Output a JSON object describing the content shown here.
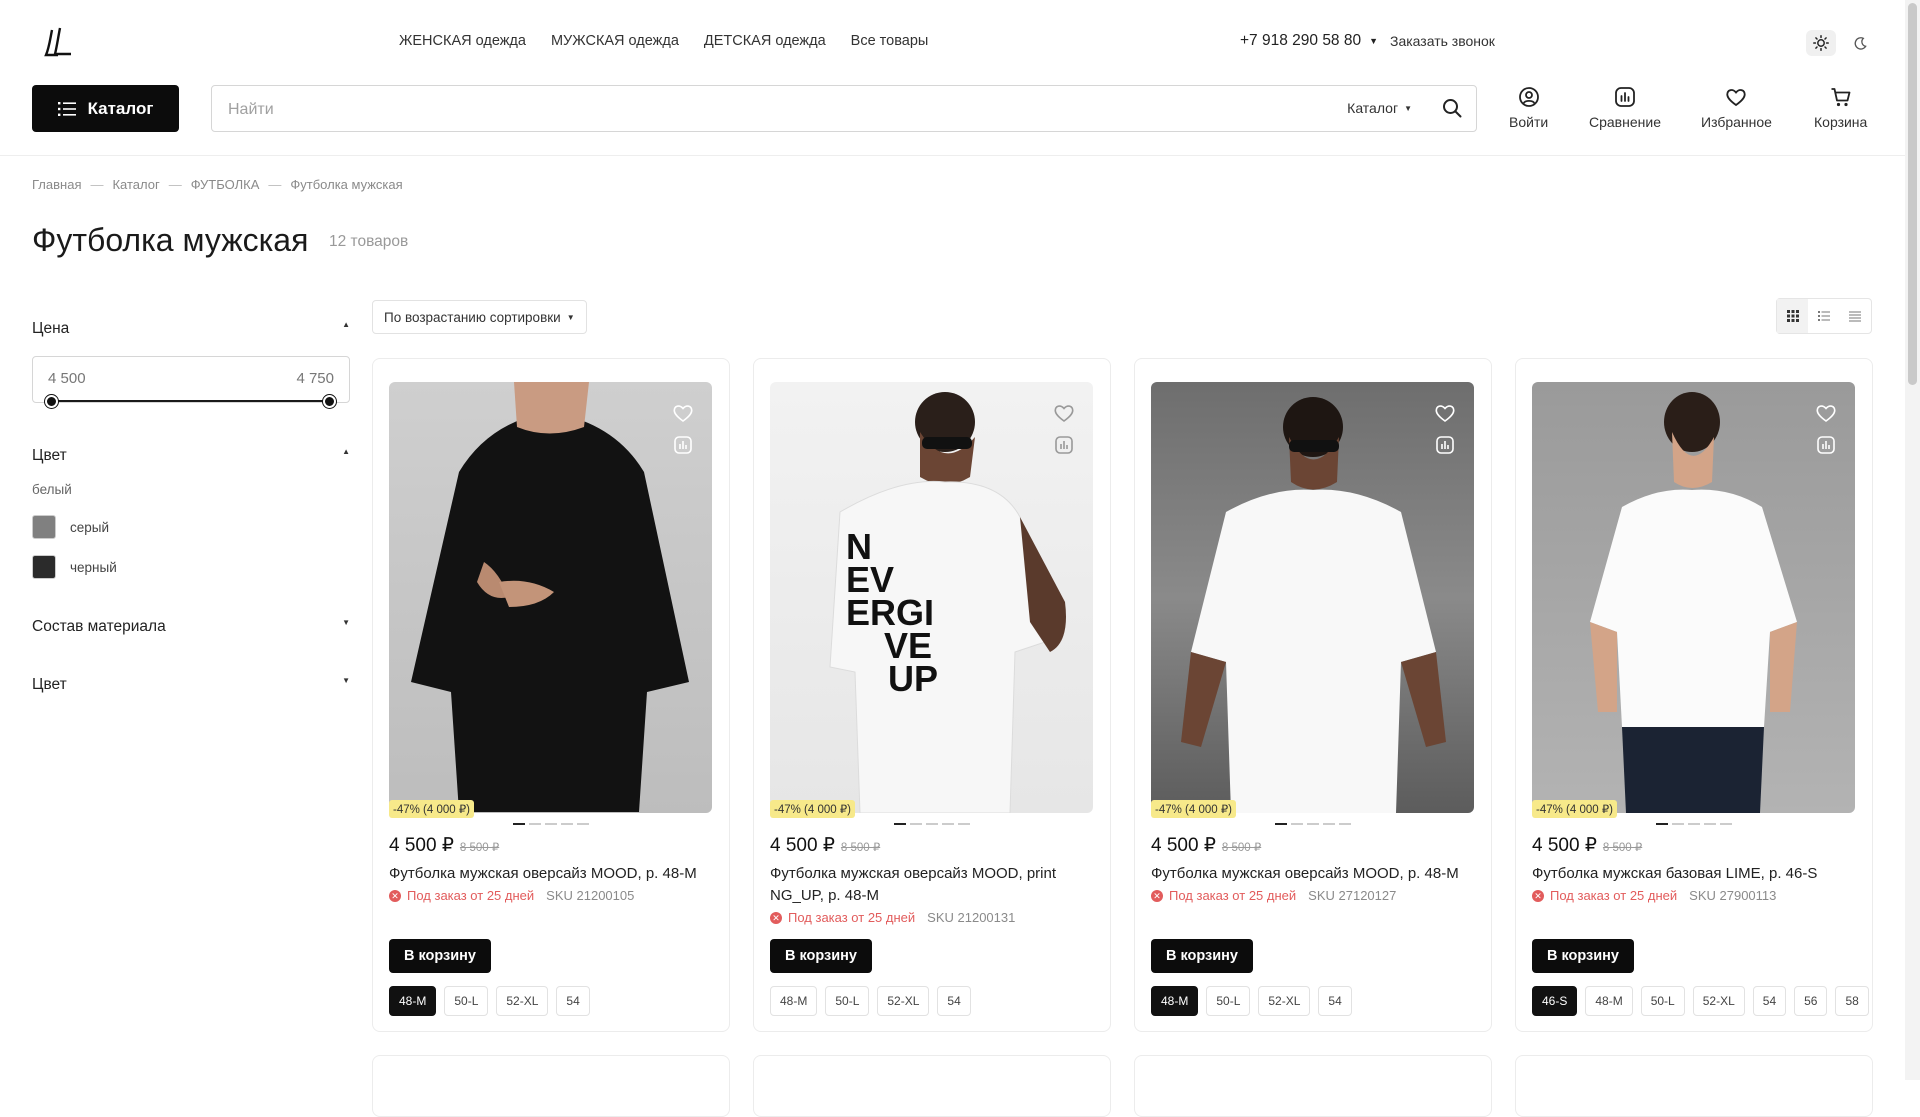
{
  "header": {
    "nav": [
      "ЖЕНСКАЯ одежда",
      "МУЖСКАЯ одежда",
      "ДЕТСКАЯ одежда",
      "Все товары"
    ],
    "phone": "+7 918 290 58 80",
    "callback": "Заказать звонок",
    "catalog_button": "Каталог",
    "search_placeholder": "Найти",
    "search_scope": "Каталог",
    "icons": [
      {
        "label": "Войти",
        "icon": "user-icon"
      },
      {
        "label": "Сравнение",
        "icon": "compare-icon"
      },
      {
        "label": "Избранное",
        "icon": "heart-icon"
      },
      {
        "label": "Корзина",
        "icon": "cart-icon"
      }
    ]
  },
  "breadcrumbs": [
    "Главная",
    "Каталог",
    "ФУТБОЛКА",
    "Футболка мужская"
  ],
  "page": {
    "title": "Футболка мужская",
    "count": "12 товаров"
  },
  "filters": {
    "price": {
      "label": "Цена",
      "min": "4 500",
      "max": "4 750"
    },
    "color": {
      "label": "Цвет",
      "selected": "белый",
      "options": [
        {
          "name": "серый",
          "color": "#808080"
        },
        {
          "name": "черный",
          "color": "#2b2b2b"
        }
      ]
    },
    "material": {
      "label": "Состав материала"
    },
    "color2": {
      "label": "Цвет"
    }
  },
  "toolbar": {
    "sort": "По возрастанию сортировки"
  },
  "products": [
    {
      "discount": "-47% (4 000 ₽)",
      "price": "4 500 ₽",
      "old_price": "8 500 ₽",
      "name": "Футболка мужская оверсайз MOOD, р. 48-M",
      "availability": "Под заказ от 25 дней",
      "sku": "SKU 21200105",
      "button": "В корзину",
      "sizes": [
        "48-M",
        "50-L",
        "52-XL",
        "54"
      ],
      "selected_size": "48-M"
    },
    {
      "discount": "-47% (4 000 ₽)",
      "price": "4 500 ₽",
      "old_price": "8 500 ₽",
      "name": "Футболка мужская оверсайз MOOD, print NG_UP, р. 48-M",
      "availability": "Под заказ от 25 дней",
      "sku": "SKU 21200131",
      "button": "В корзину",
      "sizes": [
        "48-M",
        "50-L",
        "52-XL",
        "54"
      ],
      "selected_size": "",
      "print_lines": [
        "N",
        "EV",
        "ERGI",
        "VE",
        "UP"
      ]
    },
    {
      "discount": "-47% (4 000 ₽)",
      "price": "4 500 ₽",
      "old_price": "8 500 ₽",
      "name": "Футболка мужская оверсайз MOOD, р. 48-M",
      "availability": "Под заказ от 25 дней",
      "sku": "SKU 27120127",
      "button": "В корзину",
      "sizes": [
        "48-M",
        "50-L",
        "52-XL",
        "54"
      ],
      "selected_size": "48-M"
    },
    {
      "discount": "-47% (4 000 ₽)",
      "price": "4 500 ₽",
      "old_price": "8 500 ₽",
      "name": "Футболка мужская базовая LIME, р. 46-S",
      "availability": "Под заказ от 25 дней",
      "sku": "SKU 27900113",
      "button": "В корзину",
      "sizes": [
        "46-S",
        "48-M",
        "50-L",
        "52-XL",
        "54",
        "56",
        "58"
      ],
      "selected_size": "46-S"
    }
  ]
}
